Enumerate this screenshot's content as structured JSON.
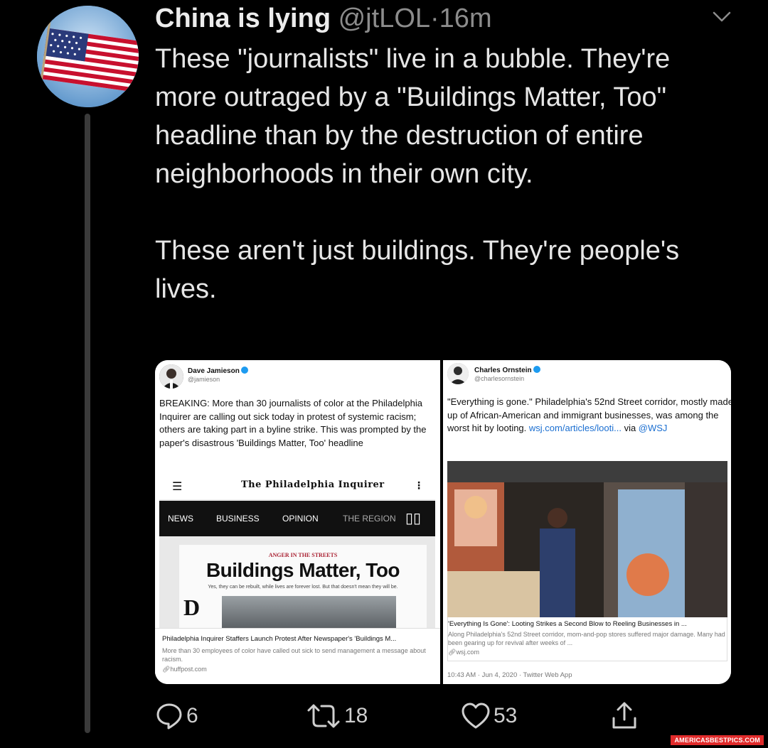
{
  "tweet": {
    "display_name": "China is lying",
    "handle": "@jtLOL",
    "separator": "·",
    "time": "16m",
    "paragraph_1": "These \"journalists\" live in a bubble. They're more outraged by a \"Buildings Matter, Too\" headline than by the destruction of entire neighborhoods in their own city.",
    "paragraph_2": "These aren't just buildings. They're people's lives."
  },
  "left_screenshot": {
    "name": "Dave Jamieson",
    "handle": "@jamieson",
    "text": "BREAKING: More than 30 journalists of color at the Philadelphia Inquirer are calling out sick today in protest of systemic racism; others are taking part in a byline strike. This was prompted by the paper's disastrous 'Buildings Matter, Too' headline",
    "paper_masthead": "The Philadelphia Inquirer",
    "nav": [
      "NEWS",
      "BUSINESS",
      "OPINION",
      "THE REGION"
    ],
    "clip_kicker": "ANGER IN THE STREETS",
    "clip_headline": "Buildings Matter, Too",
    "clip_deck": "Yes, they can be rebuilt, while lives are forever lost. But that doesn't mean they will be.",
    "card_title": "Philadelphia Inquirer Staffers Launch Protest After Newspaper's 'Buildings M...",
    "card_desc": "More than 30 employees of color have called out sick to send management a message about racism.",
    "card_source": "huffpost.com"
  },
  "right_screenshot": {
    "name": "Charles Ornstein",
    "handle": "@charlesornstein",
    "text": "\"Everything is gone.\" Philadelphia's 52nd Street corridor, mostly made up of African-American and immigrant businesses, was among the worst hit by looting.",
    "link_text": "wsj.com/articles/looti...",
    "via_text": " via ",
    "via_handle": "@WSJ",
    "card_title": "'Everything Is Gone': Looting Strikes a Second Blow to Reeling Businesses in ...",
    "card_desc": "Along Philadelphia's 52nd Street corridor, mom-and-pop stores suffered major damage. Many had been gearing up for revival after weeks of ...",
    "card_source": "wsj.com",
    "timestamp": "10:43 AM · Jun 4, 2020 · Twitter Web App"
  },
  "actions": {
    "replies": "6",
    "retweets": "18",
    "likes": "53"
  },
  "watermark": "AMERICASBESTPICS.COM"
}
